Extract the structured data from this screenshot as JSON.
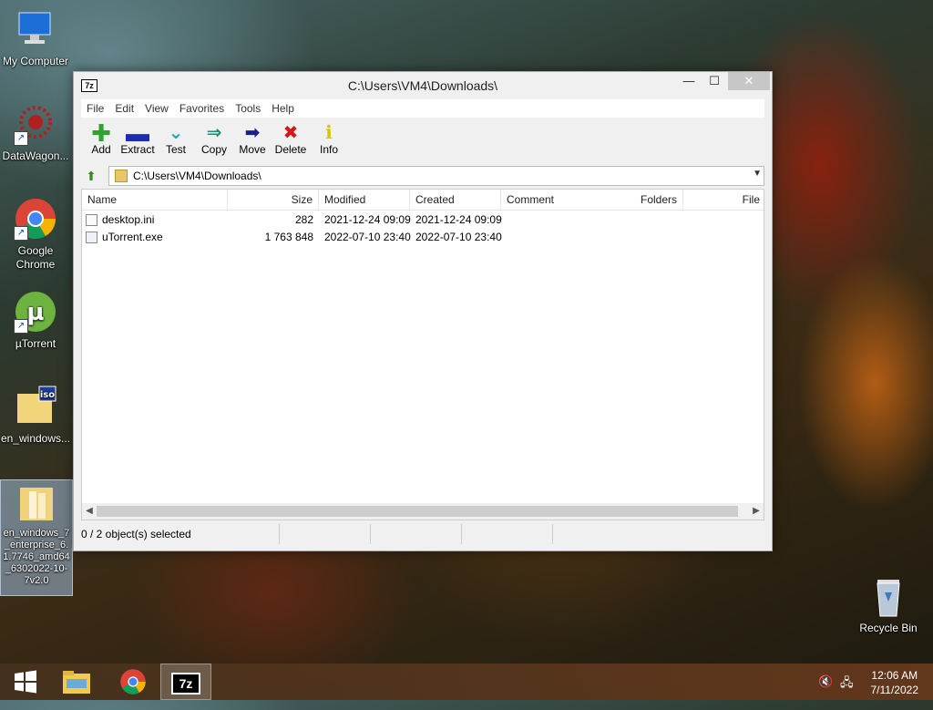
{
  "desktop": {
    "icons": [
      {
        "label": "My Computer"
      },
      {
        "label": "DataWagon..."
      },
      {
        "label": "Google Chrome"
      },
      {
        "label": "µTorrent"
      },
      {
        "label": "en_windows..."
      },
      {
        "label": "en_windows_7_enterprise_6.1.7746_amd64_6302022-10-7v2.0"
      },
      {
        "label": "Recycle Bin"
      }
    ],
    "selected_icon": "en_windows_7_enterprise_6.1.7746_amd64_6302022-10-7v2.0"
  },
  "window": {
    "icon_text": "7z",
    "title": "C:\\Users\\VM4\\Downloads\\",
    "controls": {
      "minimize": "—",
      "maximize": "☐",
      "close": "✕"
    }
  },
  "menu": [
    "File",
    "Edit",
    "View",
    "Favorites",
    "Tools",
    "Help"
  ],
  "toolbar": [
    {
      "label": "Add",
      "icon": "plus-icon",
      "color": "#2fa32f"
    },
    {
      "label": "Extract",
      "icon": "minus-icon",
      "color": "#1c2bb8"
    },
    {
      "label": "Test",
      "icon": "check-chevron-icon",
      "color": "#1aa7b8"
    },
    {
      "label": "Copy",
      "icon": "double-arrow-right-icon",
      "color": "#1d8f7a"
    },
    {
      "label": "Move",
      "icon": "arrow-right-icon",
      "color": "#1c1f8f"
    },
    {
      "label": "Delete",
      "icon": "x-icon",
      "color": "#d11a1a"
    },
    {
      "label": "Info",
      "icon": "info-icon",
      "color": "#d8c400"
    }
  ],
  "address": {
    "path": "C:\\Users\\VM4\\Downloads\\"
  },
  "list": {
    "columns": [
      "Name",
      "Size",
      "Modified",
      "Created",
      "Comment",
      "Folders",
      "File"
    ],
    "rows": [
      {
        "name": "desktop.ini",
        "size": "282",
        "modified": "2021-12-24 09:09",
        "created": "2021-12-24 09:09"
      },
      {
        "name": "uTorrent.exe",
        "size": "1 763 848",
        "modified": "2022-07-10 23:40",
        "created": "2022-07-10 23:40"
      }
    ]
  },
  "status": {
    "selection": "0 / 2 object(s) selected"
  },
  "taskbar": {
    "items": [
      "windows-start",
      "file-explorer",
      "google-chrome",
      "7zip"
    ],
    "active": "7zip",
    "clock": {
      "time": "12:06 AM",
      "date": "7/11/2022"
    }
  }
}
